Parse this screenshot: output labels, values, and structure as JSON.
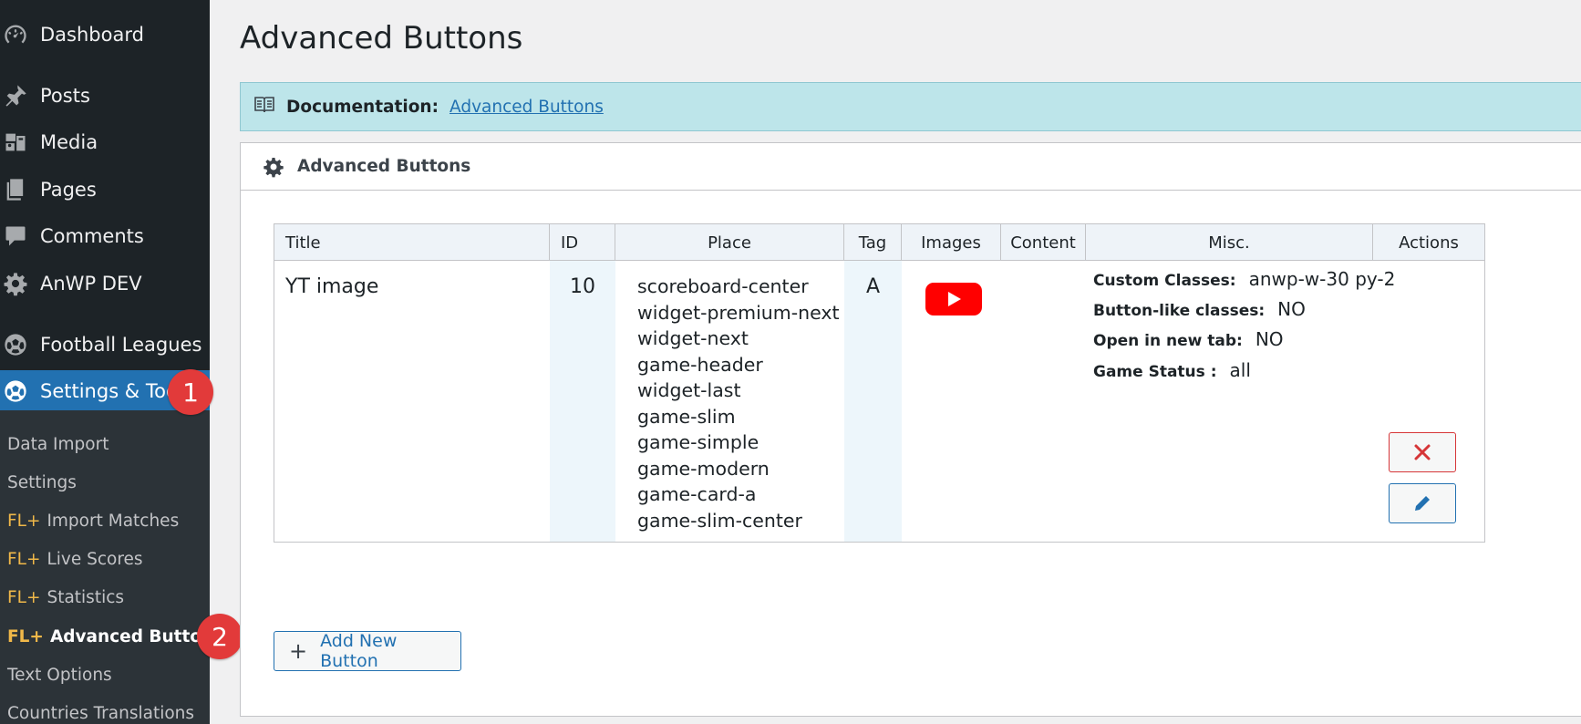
{
  "sidebar": {
    "items": [
      {
        "label": "Dashboard",
        "icon": "dashboard-icon"
      },
      {
        "label": "Posts",
        "icon": "pin-icon"
      },
      {
        "label": "Media",
        "icon": "media-icon"
      },
      {
        "label": "Pages",
        "icon": "pages-icon"
      },
      {
        "label": "Comments",
        "icon": "comment-icon"
      },
      {
        "label": "AnWP DEV",
        "icon": "gear-icon"
      },
      {
        "label": "Football Leagues",
        "icon": "football-icon"
      },
      {
        "label": "Settings & Tools",
        "icon": "football-icon"
      }
    ],
    "submenu": [
      {
        "label": "Data Import",
        "prefix": ""
      },
      {
        "label": "Settings",
        "prefix": ""
      },
      {
        "label": "Import Matches",
        "prefix": "FL+"
      },
      {
        "label": "Live Scores",
        "prefix": "FL+"
      },
      {
        "label": "Statistics",
        "prefix": "FL+"
      },
      {
        "label": "Advanced Buttons",
        "prefix": "FL+"
      },
      {
        "label": "Text Options",
        "prefix": ""
      },
      {
        "label": "Countries Translations",
        "prefix": ""
      }
    ],
    "badges": [
      "1",
      "2"
    ]
  },
  "page": {
    "title": "Advanced Buttons",
    "doc_label": "Documentation:",
    "doc_link": "Advanced Buttons",
    "panel_title": "Advanced Buttons"
  },
  "table": {
    "headers": [
      "Title",
      "ID",
      "Place",
      "Tag",
      "Images",
      "Content",
      "Misc.",
      "Actions"
    ],
    "row": {
      "title": "YT image",
      "id": "10",
      "places": [
        "scoreboard-center",
        "widget-premium-next",
        "widget-next",
        "game-header",
        "widget-last",
        "game-slim",
        "game-simple",
        "game-modern",
        "game-card-a",
        "game-slim-center"
      ],
      "tag": "A",
      "image_icon": "youtube-icon",
      "content": "",
      "misc": [
        {
          "label": "Custom Classes:",
          "value": "anwp-w-30 py-2"
        },
        {
          "label": "Button-like classes:",
          "value": "NO"
        },
        {
          "label": "Open in new tab:",
          "value": "NO"
        },
        {
          "label": "Game Status :",
          "value": "all"
        }
      ]
    }
  },
  "add_button": {
    "label": "Add New Button"
  },
  "colors": {
    "sidebar": "#1d2327",
    "submenu": "#2c3338",
    "active": "#2271b1",
    "badge": "#e23a3a",
    "fl_prefix": "#f0b849",
    "notice": "#bde5ea",
    "youtube": "#ff0000",
    "delete": "#d63638"
  }
}
